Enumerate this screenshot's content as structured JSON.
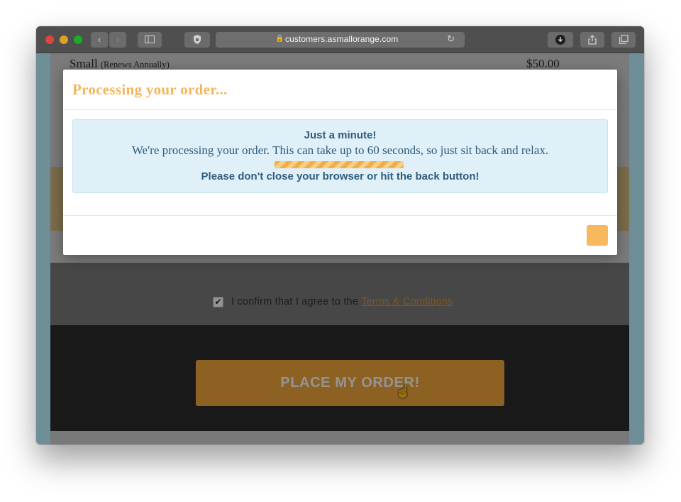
{
  "browser": {
    "url": "customers.asmallorange.com",
    "icons": {
      "back": "chevron-left-icon",
      "forward": "chevron-right-icon",
      "sidebar": "sidebar-icon",
      "privacy": "privacy-icon",
      "lock": "lock-icon",
      "reload": "reload-icon",
      "download": "download-icon",
      "share": "share-icon",
      "tabs": "tabs-icon"
    }
  },
  "order": {
    "product_name": "Small",
    "product_term": "(Renews Annually)",
    "product_price": "$50.00",
    "confirm_text": "I confirm that I agree to the",
    "terms_link": "Terms & Conditions",
    "checkbox_checked": true,
    "place_order_label": "PLACE MY ORDER!"
  },
  "modal": {
    "title": "Processing your order...",
    "heading": "Just a minute!",
    "message": "We're processing your order. This can take up to 60 seconds, so just sit back and relax.",
    "warning": "Please don't close your browser or hit the back button!",
    "progress": 1.0
  },
  "colors": {
    "accent_orange": "#f1a73c",
    "modal_title": "#f4b65c",
    "info_text": "#2f5d7c",
    "info_bg": "#dff0f9"
  }
}
